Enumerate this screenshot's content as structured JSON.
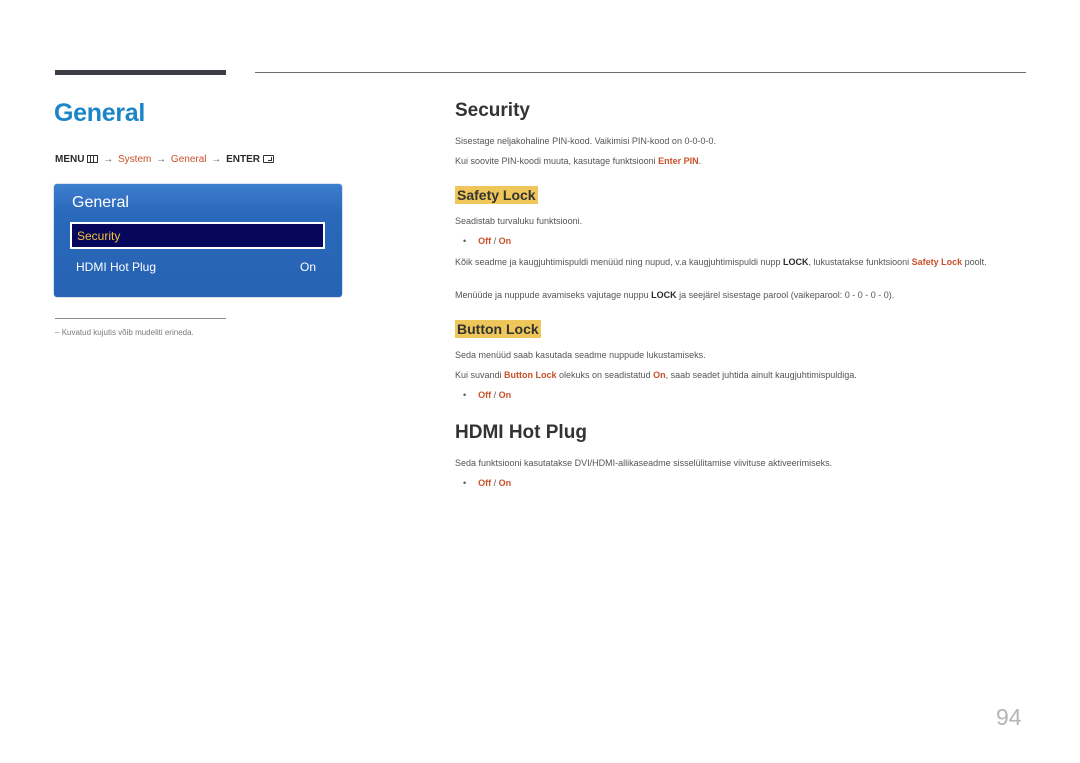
{
  "page_title": "General",
  "menu_path": {
    "menu": "MENU",
    "arrow": "→",
    "system": "System",
    "general": "General",
    "enter": "ENTER",
    "menu_icon": "menu-icon",
    "enter_icon": "enter-icon"
  },
  "osd": {
    "title": "General",
    "items": [
      {
        "label": "Security",
        "value": "",
        "selected": true
      },
      {
        "label": "HDMI Hot Plug",
        "value": "On",
        "selected": false
      }
    ]
  },
  "footnote": "Kuvatud kujutis võib mudeliti erineda.",
  "footnote_dash": "–",
  "security": {
    "title": "Security",
    "line1": "Sisestage neljakohaline PIN-kood. Vaikimisi PIN-kood on 0-0-0-0.",
    "line2_pre": "Kui soovite PIN-koodi muuta, kasutage funktsiooni ",
    "line2_hl": "Enter PIN",
    "line2_post": "."
  },
  "safety_lock": {
    "title": "Safety Lock",
    "desc": "Seadistab turvaluku funktsiooni.",
    "options": {
      "off": "Off",
      "sep": " / ",
      "on": "On"
    },
    "para1_pre": "Kõik seadme ja kaugjuhtimispuldi menüüd ning nupud, v.a kaugjuhtimispuldi nupp ",
    "para1_bold": "LOCK",
    "para1_mid": ", lukustatakse funktsiooni ",
    "para1_hl": "Safety Lock",
    "para1_post": " poolt.",
    "para2_pre": "Menüüde ja nuppude avamiseks vajutage nuppu ",
    "para2_bold": "LOCK",
    "para2_post": " ja seejärel sisestage parool (vaikeparool: 0 - 0 - 0 - 0)."
  },
  "button_lock": {
    "title": "Button Lock",
    "desc": "Seda menüüd saab kasutada seadme nuppude lukustamiseks.",
    "para_pre": "Kui suvandi ",
    "para_hl1": "Button Lock",
    "para_mid": " olekuks on seadistatud ",
    "para_hl2": "On",
    "para_post": ", saab seadet juhtida ainult kaugjuhtimispuldiga.",
    "options": {
      "off": "Off",
      "sep": " / ",
      "on": "On"
    }
  },
  "hdmi_hot_plug": {
    "title": "HDMI Hot Plug",
    "desc": "Seda funktsiooni kasutatakse DVI/HDMI-allikaseadme sisselülitamise viivituse aktiveerimiseks.",
    "options": {
      "off": "Off",
      "sep": " / ",
      "on": "On"
    }
  },
  "bullet": "•",
  "page_number": "94",
  "colors": {
    "title_blue": "#1a86c8",
    "highlight_orange": "#c8502a",
    "heading_bg_yellow": "#efc659",
    "osd_blue": "#2a68bb",
    "osd_selected_bg": "#06065a",
    "osd_selected_text": "#f4c33b"
  }
}
